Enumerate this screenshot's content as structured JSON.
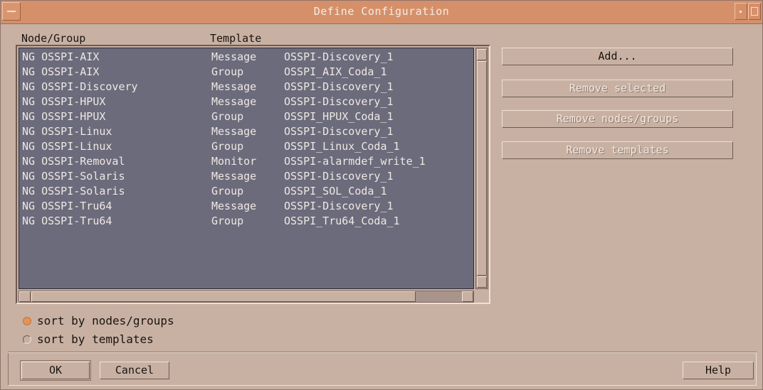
{
  "window": {
    "title": "Define Configuration"
  },
  "list": {
    "headers": {
      "node_group": "Node/Group",
      "template": "Template"
    },
    "rows": [
      {
        "node": "NG OSSPI-AIX",
        "type": "Message",
        "template": "OSSPI-Discovery_1"
      },
      {
        "node": "NG OSSPI-AIX",
        "type": "Group",
        "template": "OSSPI_AIX_Coda_1"
      },
      {
        "node": "NG OSSPI-Discovery",
        "type": "Message",
        "template": "OSSPI-Discovery_1"
      },
      {
        "node": "NG OSSPI-HPUX",
        "type": "Message",
        "template": "OSSPI-Discovery_1"
      },
      {
        "node": "NG OSSPI-HPUX",
        "type": "Group",
        "template": "OSSPI_HPUX_Coda_1"
      },
      {
        "node": "NG OSSPI-Linux",
        "type": "Message",
        "template": "OSSPI-Discovery_1"
      },
      {
        "node": "NG OSSPI-Linux",
        "type": "Group",
        "template": "OSSPI_Linux_Coda_1"
      },
      {
        "node": "NG OSSPI-Removal",
        "type": "Monitor",
        "template": "OSSPI-alarmdef_write_1"
      },
      {
        "node": "NG OSSPI-Solaris",
        "type": "Message",
        "template": "OSSPI-Discovery_1"
      },
      {
        "node": "NG OSSPI-Solaris",
        "type": "Group",
        "template": "OSSPI_SOL_Coda_1"
      },
      {
        "node": "NG OSSPI-Tru64",
        "type": "Message",
        "template": "OSSPI-Discovery_1"
      },
      {
        "node": "NG OSSPI-Tru64",
        "type": "Group",
        "template": "OSSPI_Tru64_Coda_1"
      }
    ]
  },
  "actions": {
    "add": "Add...",
    "remove_selected": "Remove selected",
    "remove_nodes_groups": "Remove nodes/groups",
    "remove_templates": "Remove templates"
  },
  "sort": {
    "by_nodes": "sort by nodes/groups",
    "by_templates": "sort by templates",
    "selected": "by_nodes"
  },
  "footer": {
    "ok": "OK",
    "cancel": "Cancel",
    "help": "Help"
  },
  "colors": {
    "window_bg": "#c8b1a3",
    "titlebar": "#d5906a",
    "list_bg": "#6b6b7c",
    "radio_selected": "#e49256"
  }
}
